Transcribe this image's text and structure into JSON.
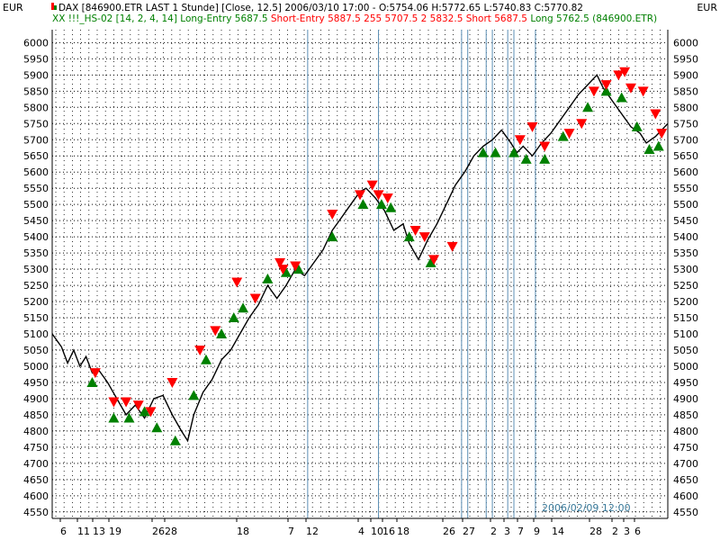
{
  "header": {
    "currency_left": "EUR",
    "currency_right": "EUR",
    "line1": "DAX [846900.ETR LAST 1 Stunde] [Close, 12.5] 2006/03/10 17:00 - O:5754.06 H:5772.65 L:5740.83 C:5770.82",
    "line2_parts": [
      {
        "text": "XX !!!_HS-02 [14, 2, 4, 14] Long-Entry 5687.5 ",
        "role": "long"
      },
      {
        "text": "Short-Entry 5887.5 255 5707.5 2 5832.5 Short 5687.5 ",
        "role": "short"
      },
      {
        "text": "Long 5762.5 (846900.ETR)",
        "role": "long"
      }
    ]
  },
  "cursor_label": "2006/02/09 12:00",
  "colors": {
    "line": "#000000",
    "long": "#008000",
    "short": "#ff0000",
    "vline": "#5b8fb5",
    "grid": "#000000",
    "text": "#000000",
    "cursor_text": "#3a7a9a"
  },
  "chart_data": {
    "type": "line",
    "title": "DAX [846900.ETR LAST 1 Stunde] [Close, 12.5]",
    "y_axis": {
      "ylim": [
        4530,
        6040
      ],
      "ticks": [
        4550,
        4600,
        4650,
        4700,
        4750,
        4800,
        4850,
        4900,
        4950,
        5000,
        5050,
        5100,
        5150,
        5200,
        5250,
        5300,
        5350,
        5400,
        5450,
        5500,
        5550,
        5600,
        5650,
        5700,
        5750,
        5800,
        5850,
        5900,
        5950,
        6000
      ],
      "unit": "EUR"
    },
    "x_axis": {
      "tick_labels": [
        "6",
        "11",
        "13",
        "19",
        "26",
        "28",
        "18",
        "7",
        "12",
        "4",
        "10",
        "16",
        "18",
        "26",
        "27",
        "2",
        "3",
        "7",
        "9",
        "14",
        "28",
        "2",
        "3",
        "6"
      ],
      "range": [
        0,
        100
      ]
    },
    "series": [
      {
        "points": [
          [
            0,
            5100
          ],
          [
            1.5,
            5060
          ],
          [
            2.5,
            5010
          ],
          [
            3.5,
            5050
          ],
          [
            4.5,
            5000
          ],
          [
            5.5,
            5030
          ],
          [
            6.5,
            4980
          ],
          [
            7.5,
            4990
          ],
          [
            9,
            4950
          ],
          [
            10.5,
            4900
          ],
          [
            12,
            4850
          ],
          [
            13.5,
            4880
          ],
          [
            15,
            4840
          ],
          [
            16.5,
            4900
          ],
          [
            18,
            4910
          ],
          [
            19.5,
            4850
          ],
          [
            21,
            4800
          ],
          [
            22,
            4770
          ],
          [
            23,
            4850
          ],
          [
            24.5,
            4920
          ],
          [
            26,
            4960
          ],
          [
            27.5,
            5020
          ],
          [
            29,
            5050
          ],
          [
            30.5,
            5100
          ],
          [
            32,
            5150
          ],
          [
            33.5,
            5190
          ],
          [
            35,
            5250
          ],
          [
            36.5,
            5210
          ],
          [
            38,
            5250
          ],
          [
            39.5,
            5300
          ],
          [
            41,
            5280
          ],
          [
            42.5,
            5320
          ],
          [
            44,
            5360
          ],
          [
            45.5,
            5420
          ],
          [
            47,
            5460
          ],
          [
            48.5,
            5500
          ],
          [
            50,
            5540
          ],
          [
            51,
            5550
          ],
          [
            52.5,
            5520
          ],
          [
            54,
            5480
          ],
          [
            55.5,
            5420
          ],
          [
            57,
            5440
          ],
          [
            58,
            5380
          ],
          [
            59.5,
            5330
          ],
          [
            61,
            5390
          ],
          [
            62.5,
            5440
          ],
          [
            64,
            5500
          ],
          [
            65.5,
            5560
          ],
          [
            67,
            5600
          ],
          [
            68.5,
            5650
          ],
          [
            70,
            5680
          ],
          [
            71.5,
            5700
          ],
          [
            73,
            5730
          ],
          [
            74.5,
            5690
          ],
          [
            75.5,
            5660
          ],
          [
            76.5,
            5680
          ],
          [
            78,
            5650
          ],
          [
            79.5,
            5690
          ],
          [
            81,
            5720
          ],
          [
            82.5,
            5760
          ],
          [
            84,
            5800
          ],
          [
            85.5,
            5840
          ],
          [
            87,
            5870
          ],
          [
            88.5,
            5900
          ],
          [
            89.5,
            5860
          ],
          [
            91,
            5820
          ],
          [
            92.5,
            5780
          ],
          [
            94,
            5740
          ],
          [
            95.5,
            5720
          ],
          [
            96.5,
            5690
          ],
          [
            98,
            5710
          ],
          [
            100,
            5750
          ]
        ]
      }
    ],
    "short_entries": [
      [
        7,
        4980
      ],
      [
        10,
        4890
      ],
      [
        12,
        4890
      ],
      [
        14,
        4880
      ],
      [
        16,
        4860
      ],
      [
        19.5,
        4950
      ],
      [
        24,
        5050
      ],
      [
        26.5,
        5110
      ],
      [
        30,
        5260
      ],
      [
        33,
        5210
      ],
      [
        37,
        5320
      ],
      [
        37.5,
        5300
      ],
      [
        39.5,
        5310
      ],
      [
        45.5,
        5470
      ],
      [
        50,
        5530
      ],
      [
        52,
        5560
      ],
      [
        53,
        5530
      ],
      [
        54.5,
        5520
      ],
      [
        59,
        5420
      ],
      [
        60.5,
        5400
      ],
      [
        62,
        5330
      ],
      [
        65,
        5370
      ],
      [
        76,
        5700
      ],
      [
        78,
        5740
      ],
      [
        80,
        5680
      ],
      [
        84,
        5720
      ],
      [
        86,
        5750
      ],
      [
        88,
        5850
      ],
      [
        90,
        5870
      ],
      [
        92,
        5900
      ],
      [
        93,
        5910
      ],
      [
        94,
        5860
      ],
      [
        96,
        5850
      ],
      [
        98,
        5780
      ],
      [
        99,
        5720
      ]
    ],
    "long_entries": [
      [
        6.5,
        4950
      ],
      [
        10,
        4840
      ],
      [
        12.5,
        4840
      ],
      [
        15,
        4860
      ],
      [
        17,
        4810
      ],
      [
        20,
        4770
      ],
      [
        23,
        4910
      ],
      [
        25,
        5020
      ],
      [
        27.5,
        5100
      ],
      [
        29.5,
        5150
      ],
      [
        31,
        5180
      ],
      [
        35,
        5270
      ],
      [
        38,
        5290
      ],
      [
        40,
        5300
      ],
      [
        45.5,
        5400
      ],
      [
        50.5,
        5500
      ],
      [
        53.5,
        5500
      ],
      [
        55,
        5490
      ],
      [
        58,
        5400
      ],
      [
        61.5,
        5320
      ],
      [
        70,
        5660
      ],
      [
        72,
        5660
      ],
      [
        75,
        5660
      ],
      [
        77,
        5640
      ],
      [
        80,
        5640
      ],
      [
        83,
        5710
      ],
      [
        87,
        5800
      ],
      [
        90,
        5850
      ],
      [
        92.5,
        5830
      ],
      [
        95,
        5740
      ],
      [
        97,
        5670
      ],
      [
        98.5,
        5680
      ]
    ],
    "vertical_lines_x": [
      41.5,
      53,
      66.5,
      67.5,
      70.5,
      71.5,
      74,
      75,
      78.5
    ]
  }
}
